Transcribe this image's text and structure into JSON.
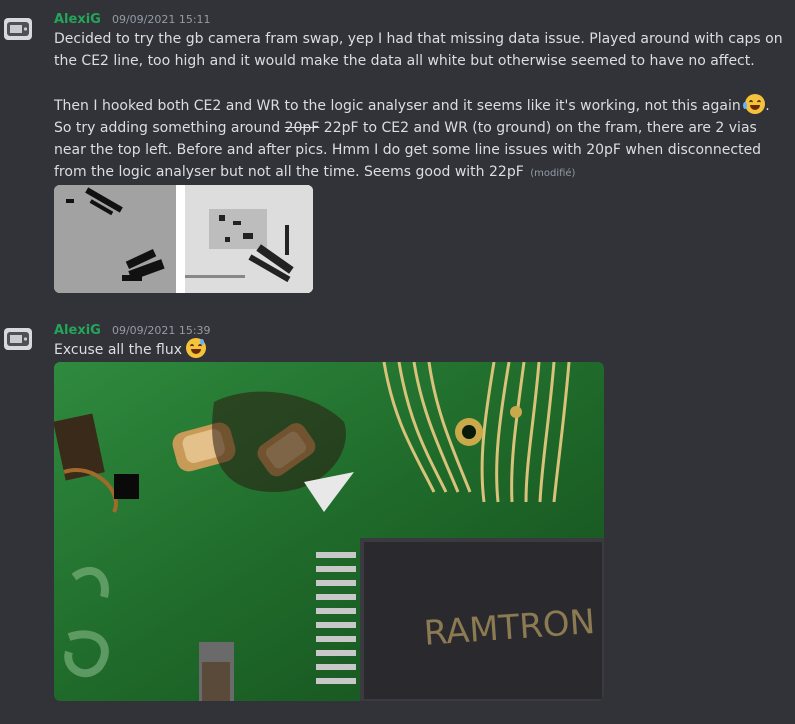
{
  "messages": [
    {
      "author": "AlexiG",
      "timestamp": "09/09/2021 15:11",
      "paragraph1": "Decided to try the gb camera fram swap, yep I had that missing data issue. Played around with caps on the CE2 line, too high and it would make the data all white but otherwise seemed to have no affect.",
      "p2_part1": "Then I hooked both CE2 and WR to the logic analyser and it seems like it's working, not this again",
      "p2_emoji": "joy-emoji",
      "p2_part2": ". So try adding something around ",
      "p2_strike": "20pF",
      "p2_part3": " 22pF to CE2 and WR (to ground) on the fram, there are 2 vias near the top left. Before and after pics. Hmm I do get some line issues with 20pF when disconnected from the logic analyser but not all the time. Seems good with 22pF",
      "edited_label": "(modifié)",
      "attachments": [
        "before-pic",
        "after-pic"
      ]
    },
    {
      "author": "AlexiG",
      "timestamp": "09/09/2021 15:39",
      "text": "Excuse all the flux",
      "emoji": "sweat-smile-emoji",
      "photo_chip_text": "RAMTRON"
    }
  ],
  "colors": {
    "background": "#313338",
    "author": "#23a55a",
    "text": "#dbdee1",
    "muted": "#949ba4"
  }
}
